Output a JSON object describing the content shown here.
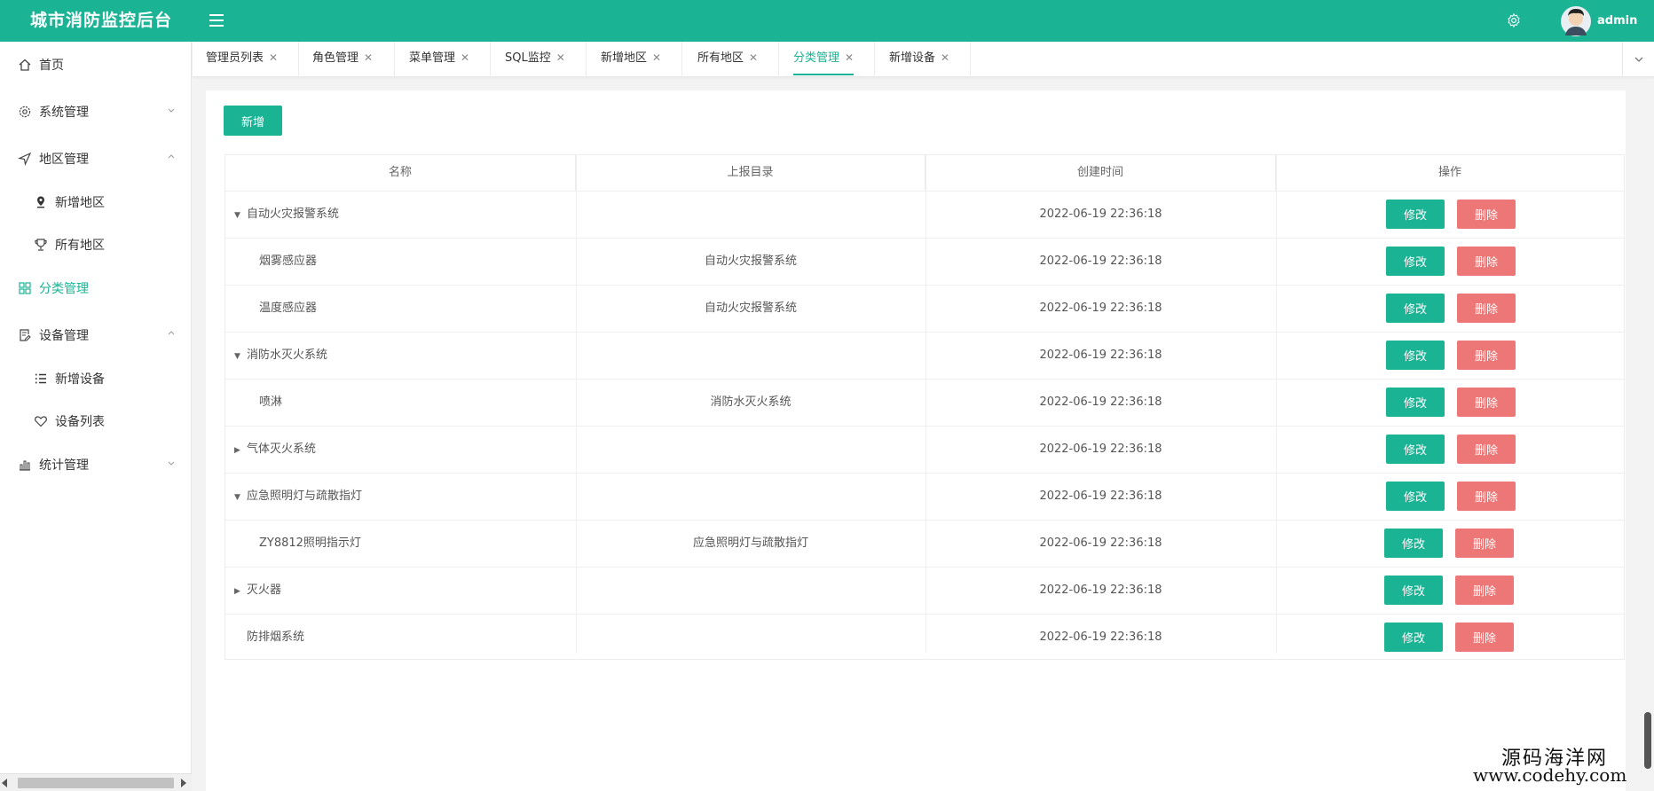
{
  "header": {
    "title": "城市消防监控后台",
    "user": "admin",
    "colors": {
      "primary": "#1ab394",
      "danger": "#ed7676"
    }
  },
  "sidebar": {
    "items": [
      {
        "label": "首页",
        "icon": "home-icon"
      },
      {
        "label": "系统管理",
        "icon": "gear-icon"
      },
      {
        "label": "地区管理",
        "icon": "navigation-icon"
      },
      {
        "label": "新增地区",
        "icon": "location-pin-icon"
      },
      {
        "label": "所有地区",
        "icon": "trophy-icon"
      },
      {
        "label": "分类管理",
        "icon": "grid-icon"
      },
      {
        "label": "设备管理",
        "icon": "document-edit-icon"
      },
      {
        "label": "新增设备",
        "icon": "list-icon"
      },
      {
        "label": "设备列表",
        "icon": "heart-icon"
      },
      {
        "label": "统计管理",
        "icon": "bar-chart-icon"
      }
    ]
  },
  "tabs": [
    {
      "label": "管理员列表"
    },
    {
      "label": "角色管理"
    },
    {
      "label": "菜单管理"
    },
    {
      "label": "SQL监控"
    },
    {
      "label": "新增地区"
    },
    {
      "label": "所有地区"
    },
    {
      "label": "分类管理",
      "active": true
    },
    {
      "label": "新增设备"
    }
  ],
  "toolbar": {
    "add_label": "新增"
  },
  "table": {
    "columns": [
      "名称",
      "上报目录",
      "创建时间",
      "操作"
    ],
    "edit_label": "修改",
    "delete_label": "删除",
    "rows": [
      {
        "name": "自动火灾报警系统",
        "parent": "",
        "time": "2022-06-19 22:36:18"
      },
      {
        "name": "烟雾感应器",
        "parent": "自动火灾报警系统",
        "time": "2022-06-19 22:36:18"
      },
      {
        "name": "温度感应器",
        "parent": "自动火灾报警系统",
        "time": "2022-06-19 22:36:18"
      },
      {
        "name": "消防水灭火系统",
        "parent": "",
        "time": "2022-06-19 22:36:18"
      },
      {
        "name": "喷淋",
        "parent": "消防水灭火系统",
        "time": "2022-06-19 22:36:18"
      },
      {
        "name": "气体灭火系统",
        "parent": "",
        "time": "2022-06-19 22:36:18"
      },
      {
        "name": "应急照明灯与疏散指灯",
        "parent": "",
        "time": "2022-06-19 22:36:18"
      },
      {
        "name": "ZY8812照明指示灯",
        "parent": "应急照明灯与疏散指灯",
        "time": "2022-06-19 22:36:18"
      },
      {
        "name": "灭火器",
        "parent": "",
        "time": "2022-06-19 22:36:18"
      },
      {
        "name": "防排烟系统",
        "parent": "",
        "time": "2022-06-19 22:36:18"
      }
    ]
  },
  "watermark": {
    "line1": "源码海洋网",
    "line2": "www.codehy.com"
  }
}
